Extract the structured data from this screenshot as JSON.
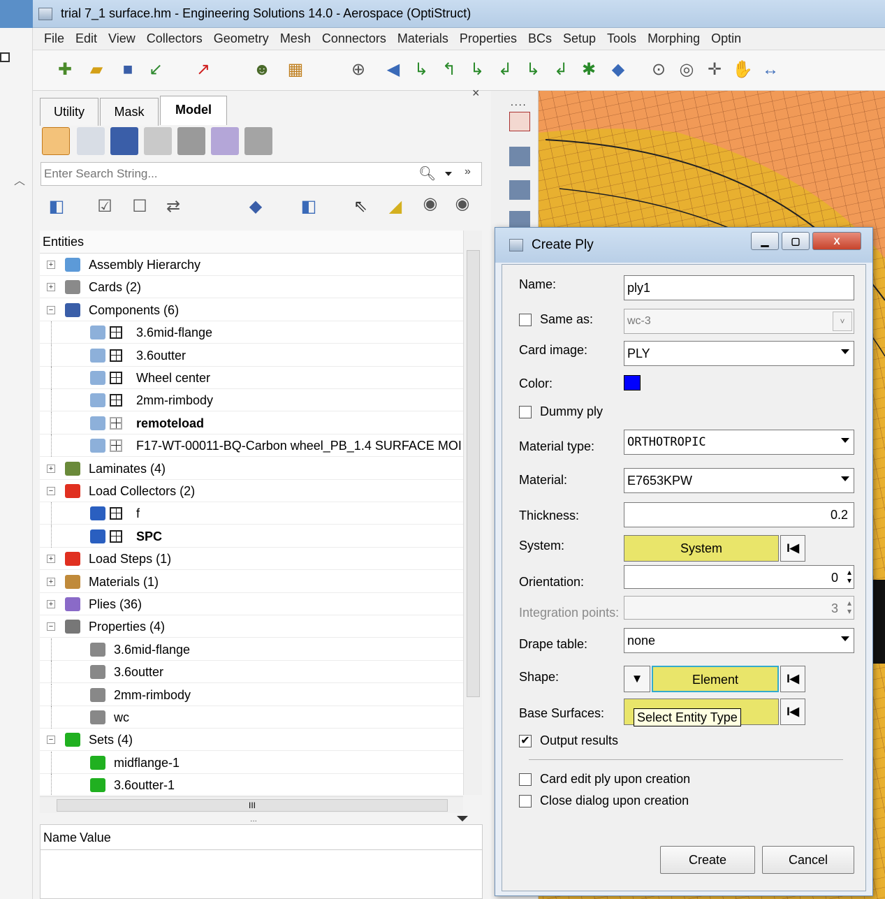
{
  "window": {
    "title": "trial 7_1 surface.hm - Engineering Solutions 14.0 - Aerospace (OptiStruct)"
  },
  "menu": [
    "File",
    "Edit",
    "View",
    "Collectors",
    "Geometry",
    "Mesh",
    "Connectors",
    "Materials",
    "Properties",
    "BCs",
    "Setup",
    "Tools",
    "Morphing",
    "Optin"
  ],
  "panel": {
    "tabs": [
      "Utility",
      "Mask",
      "Model"
    ],
    "close_glyph": "×",
    "search_placeholder": "Enter Search String...",
    "entities_header": "Entities",
    "tree": [
      {
        "label": "Assembly Hierarchy",
        "level": 0,
        "expander": "+",
        "icon": "assembly-icon"
      },
      {
        "label": "Cards (2)",
        "level": 0,
        "expander": "+",
        "icon": "cards-icon"
      },
      {
        "label": "Components (6)",
        "level": 0,
        "expander": "−",
        "icon": "components-icon"
      },
      {
        "label": "3.6mid-flange",
        "level": 1,
        "icon": "component-icon"
      },
      {
        "label": "3.6outter",
        "level": 1,
        "icon": "component-icon"
      },
      {
        "label": "Wheel center",
        "level": 1,
        "icon": "component-icon"
      },
      {
        "label": "2mm-rimbody",
        "level": 1,
        "icon": "component-icon"
      },
      {
        "label": "remoteload",
        "level": 1,
        "icon": "component-icon",
        "bold": true
      },
      {
        "label": "F17-WT-00011-BQ-Carbon wheel_PB_1.4 SURFACE MOI",
        "level": 1,
        "icon": "component-icon"
      },
      {
        "label": "Laminates (4)",
        "level": 0,
        "expander": "+",
        "icon": "laminates-icon"
      },
      {
        "label": "Load Collectors (2)",
        "level": 0,
        "expander": "−",
        "icon": "load-collectors-icon"
      },
      {
        "label": "f",
        "level": 1,
        "icon": "load-collector-icon"
      },
      {
        "label": "SPC",
        "level": 1,
        "icon": "load-collector-icon",
        "bold": true
      },
      {
        "label": "Load Steps (1)",
        "level": 0,
        "expander": "+",
        "icon": "load-steps-icon"
      },
      {
        "label": "Materials (1)",
        "level": 0,
        "expander": "+",
        "icon": "materials-icon"
      },
      {
        "label": "Plies (36)",
        "level": 0,
        "expander": "+",
        "icon": "plies-icon"
      },
      {
        "label": "Properties (4)",
        "level": 0,
        "expander": "−",
        "icon": "properties-icon"
      },
      {
        "label": "3.6mid-flange",
        "level": 1,
        "icon": "property-icon"
      },
      {
        "label": "3.6outter",
        "level": 1,
        "icon": "property-icon"
      },
      {
        "label": "2mm-rimbody",
        "level": 1,
        "icon": "property-icon"
      },
      {
        "label": "wc",
        "level": 1,
        "icon": "property-icon"
      },
      {
        "label": "Sets (4)",
        "level": 0,
        "expander": "−",
        "icon": "sets-icon"
      },
      {
        "label": "midflange-1",
        "level": 1,
        "icon": "set-icon"
      },
      {
        "label": "3.6outter-1",
        "level": 1,
        "icon": "set-icon"
      }
    ],
    "hscroll_grip": "III",
    "splitter_grip": "...",
    "props_header": {
      "name": "Name",
      "value": "Value"
    }
  },
  "dialog": {
    "title": "Create Ply",
    "name_label": "Name:",
    "name_value": "ply1",
    "same_as_label": "Same as:",
    "same_as_value": "wc-3",
    "same_as_checked": false,
    "card_image_label": "Card image:",
    "card_image_value": "PLY",
    "color_label": "Color:",
    "color_value": "#0000ff",
    "dummy_ply_label": "Dummy ply",
    "dummy_ply_checked": false,
    "material_type_label": "Material type:",
    "material_type_value": "ORTHOTROPIC",
    "material_label": "Material:",
    "material_value": "E7653KPW",
    "thickness_label": "Thickness:",
    "thickness_value": "0.2",
    "system_label": "System:",
    "system_button": "System",
    "orientation_label": "Orientation:",
    "orientation_value": "0",
    "integration_label": "Integration points:",
    "integration_value": "3",
    "drape_label": "Drape table:",
    "drape_value": "none",
    "shape_label": "Shape:",
    "shape_button": "Element",
    "base_surfaces_label": "Base Surfaces:",
    "tooltip": "Select Entity Type",
    "output_results_label": "Output results",
    "output_results_checked": true,
    "card_edit_label": "Card edit ply upon creation",
    "card_edit_checked": false,
    "close_dialog_label": "Close dialog upon creation",
    "close_dialog_checked": false,
    "create_button": "Create",
    "cancel_button": "Cancel",
    "reset_glyph": "I◀"
  },
  "colors": {
    "accent_yellow": "#e9e56a",
    "viewport_orange": "#f19a57",
    "viewport_yellow": "#e8b030",
    "ply_blue": "#0000ff"
  }
}
